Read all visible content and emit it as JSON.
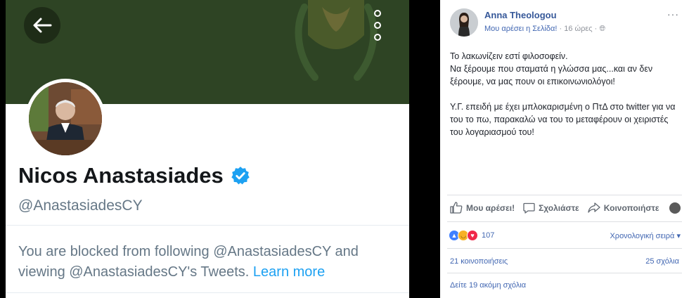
{
  "twitter": {
    "back_icon": "arrow-left-icon",
    "more_icon": "vertical-dots-icon",
    "name": "Nicos Anastasiades",
    "verified_icon": "verified-badge-icon",
    "handle": "@AnastasiadesCY",
    "blocked_text": "You are blocked from following @AnastasiadesCY and viewing @AnastasiadesCY's Tweets.",
    "learn_more": "Learn more",
    "colors": {
      "banner": "#2e4424",
      "link": "#1da1f2",
      "verified": "#1da1f2"
    }
  },
  "facebook": {
    "author": "Anna Theologou",
    "page_like": "Μου αρέσει η Σελίδα!",
    "time": "16 ώρες",
    "privacy_icon": "globe-icon",
    "more_icon": "horizontal-dots-icon",
    "post_lines": [
      "Το λακωνίζειν εστί φιλοσοφείν.",
      "Να ξέρουμε που σταματά η γλώσσα μας...και αν δεν ξέρουμε, να μας πουν οι επικοινωνιολόγοι!",
      "Υ.Γ. επειδή με έχει μπλοκαρισμένη ο ΠτΔ στο twitter για να του το πω, παρακαλώ να του το μεταφέρουν οι χειριστές του λογαριασμού του!"
    ],
    "actions": {
      "like": "Μου αρέσει!",
      "comment": "Σχολιάστε",
      "share": "Κοινοποιήστε"
    },
    "reactions_count": "107",
    "order": "Χρονολογική σειρά ▾",
    "shares": "21 κοινοποιήσεις",
    "comments": "25 σχόλια",
    "more_comments": "Δείτε 19 ακόμη σχόλια",
    "colors": {
      "link": "#4267b2",
      "name": "#365899"
    }
  }
}
